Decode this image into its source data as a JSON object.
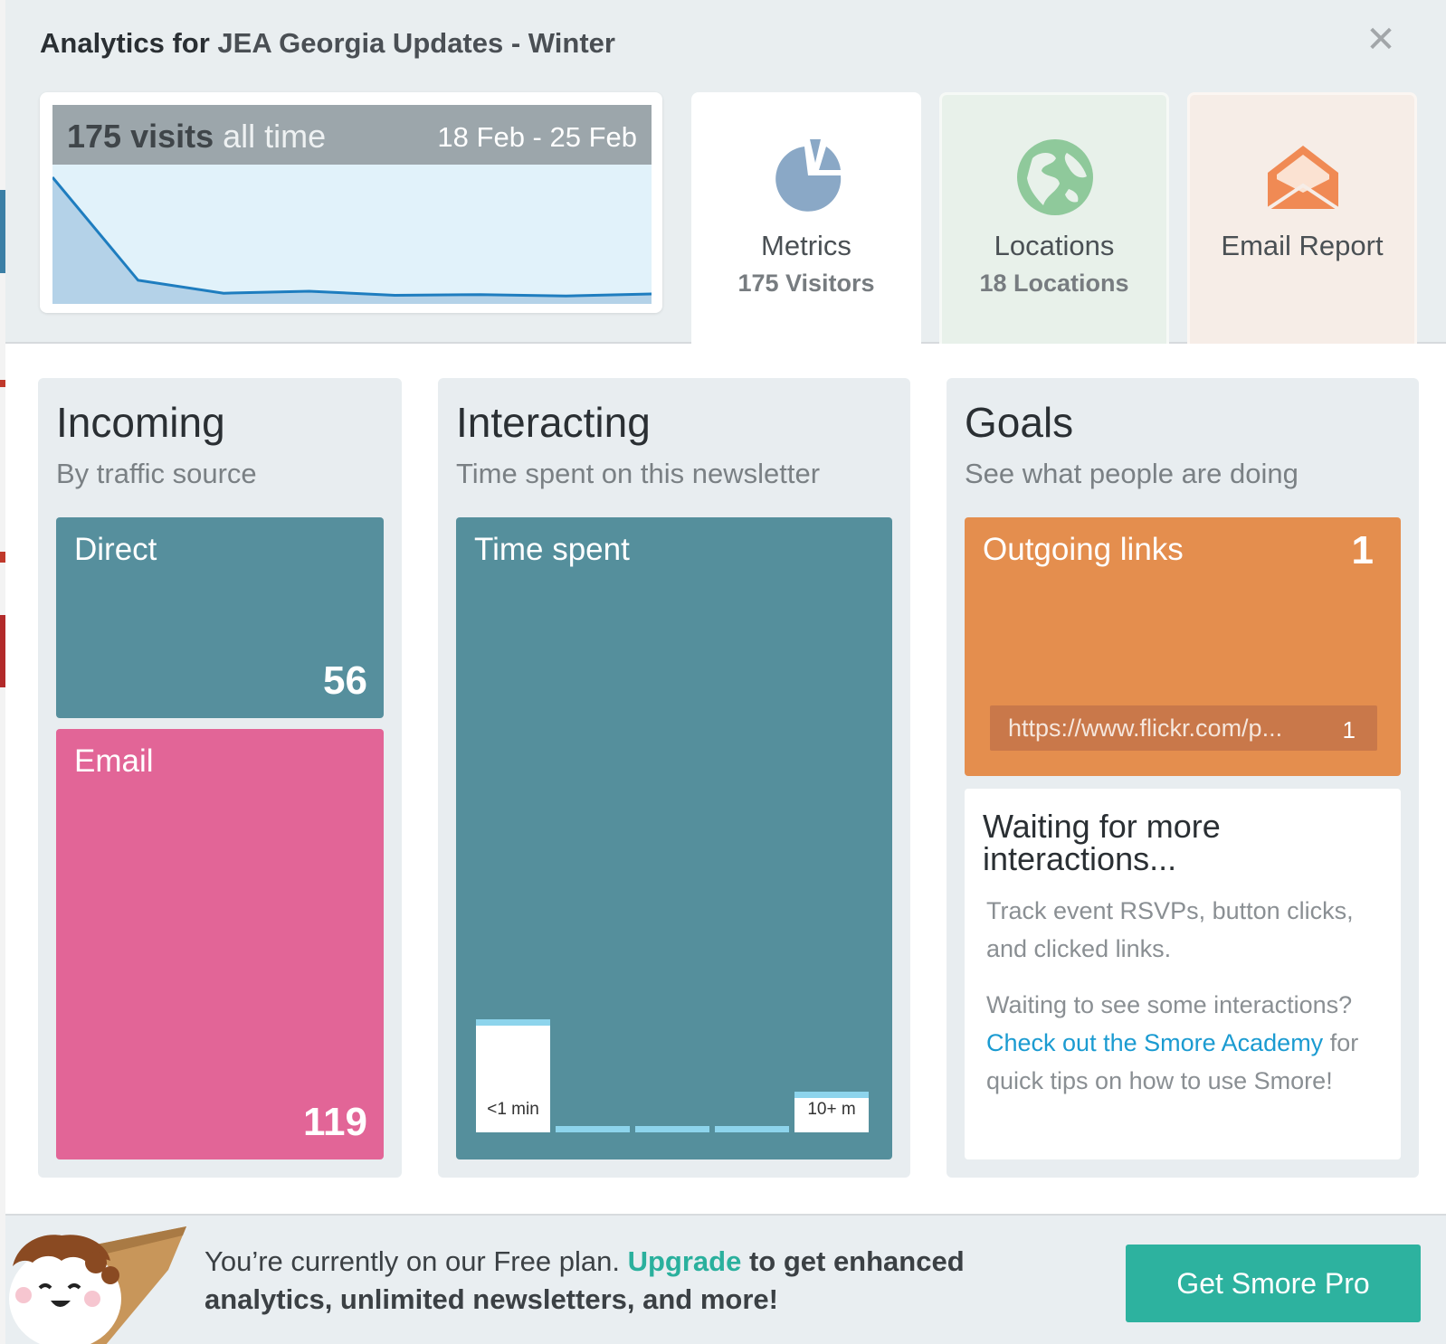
{
  "header": {
    "title_prefix": "Analytics for",
    "newsletter_name": "JEA Georgia Updates - Winter",
    "close_glyph": "✕"
  },
  "visits": {
    "count": "175 visits",
    "period": "all time",
    "date_range": "18 Feb - 25 Feb",
    "series": [
      175,
      24,
      5,
      8,
      2,
      3,
      1,
      4
    ]
  },
  "tabs": [
    {
      "label": "Metrics",
      "sub": "175 Visitors",
      "icon": "pie-chart-icon",
      "color": "#8aa8c6"
    },
    {
      "label": "Locations",
      "sub": "18 Locations",
      "icon": "globe-icon",
      "color": "#8fc99b"
    },
    {
      "label": "Email Report",
      "sub": "",
      "icon": "envelope-icon",
      "color": "#f08a54"
    }
  ],
  "incoming": {
    "title": "Incoming",
    "subtitle": "By traffic source",
    "direct": {
      "label": "Direct",
      "value": "56"
    },
    "email": {
      "label": "Email",
      "value": "119"
    }
  },
  "interacting": {
    "title": "Interacting",
    "subtitle": "Time spent on this newsletter",
    "block_label": "Time spent",
    "first_label": "<1 min",
    "last_label": "10+ m",
    "buckets": [
      1,
      0,
      0,
      0,
      0.36
    ]
  },
  "goals": {
    "title": "Goals",
    "subtitle": "See what people are doing",
    "outgoing_label": "Outgoing links",
    "outgoing_count": "1",
    "link_url": "https://www.flickr.com/p...",
    "link_count": "1",
    "waiting_title": "Waiting for more interactions...",
    "waiting_p1": "Track event RSVPs, button clicks, and clicked links.",
    "waiting_p2_pre": "Waiting to see some interactions?",
    "academy_link": "Check out the Smore Academy",
    "waiting_p2_post": "for quick tips on how to use Smore!"
  },
  "footer": {
    "text_pre": "You’re currently on our Free plan.",
    "upgrade": "Upgrade",
    "text_bold": "to get enhanced analytics, unlimited newsletters, and more!",
    "button": "Get Smore Pro"
  },
  "colors": {
    "direct": "#568f9d",
    "email": "#e26597",
    "outgoing": "#e48e4e",
    "accent": "#2db29f",
    "link": "#1b9bd1"
  }
}
